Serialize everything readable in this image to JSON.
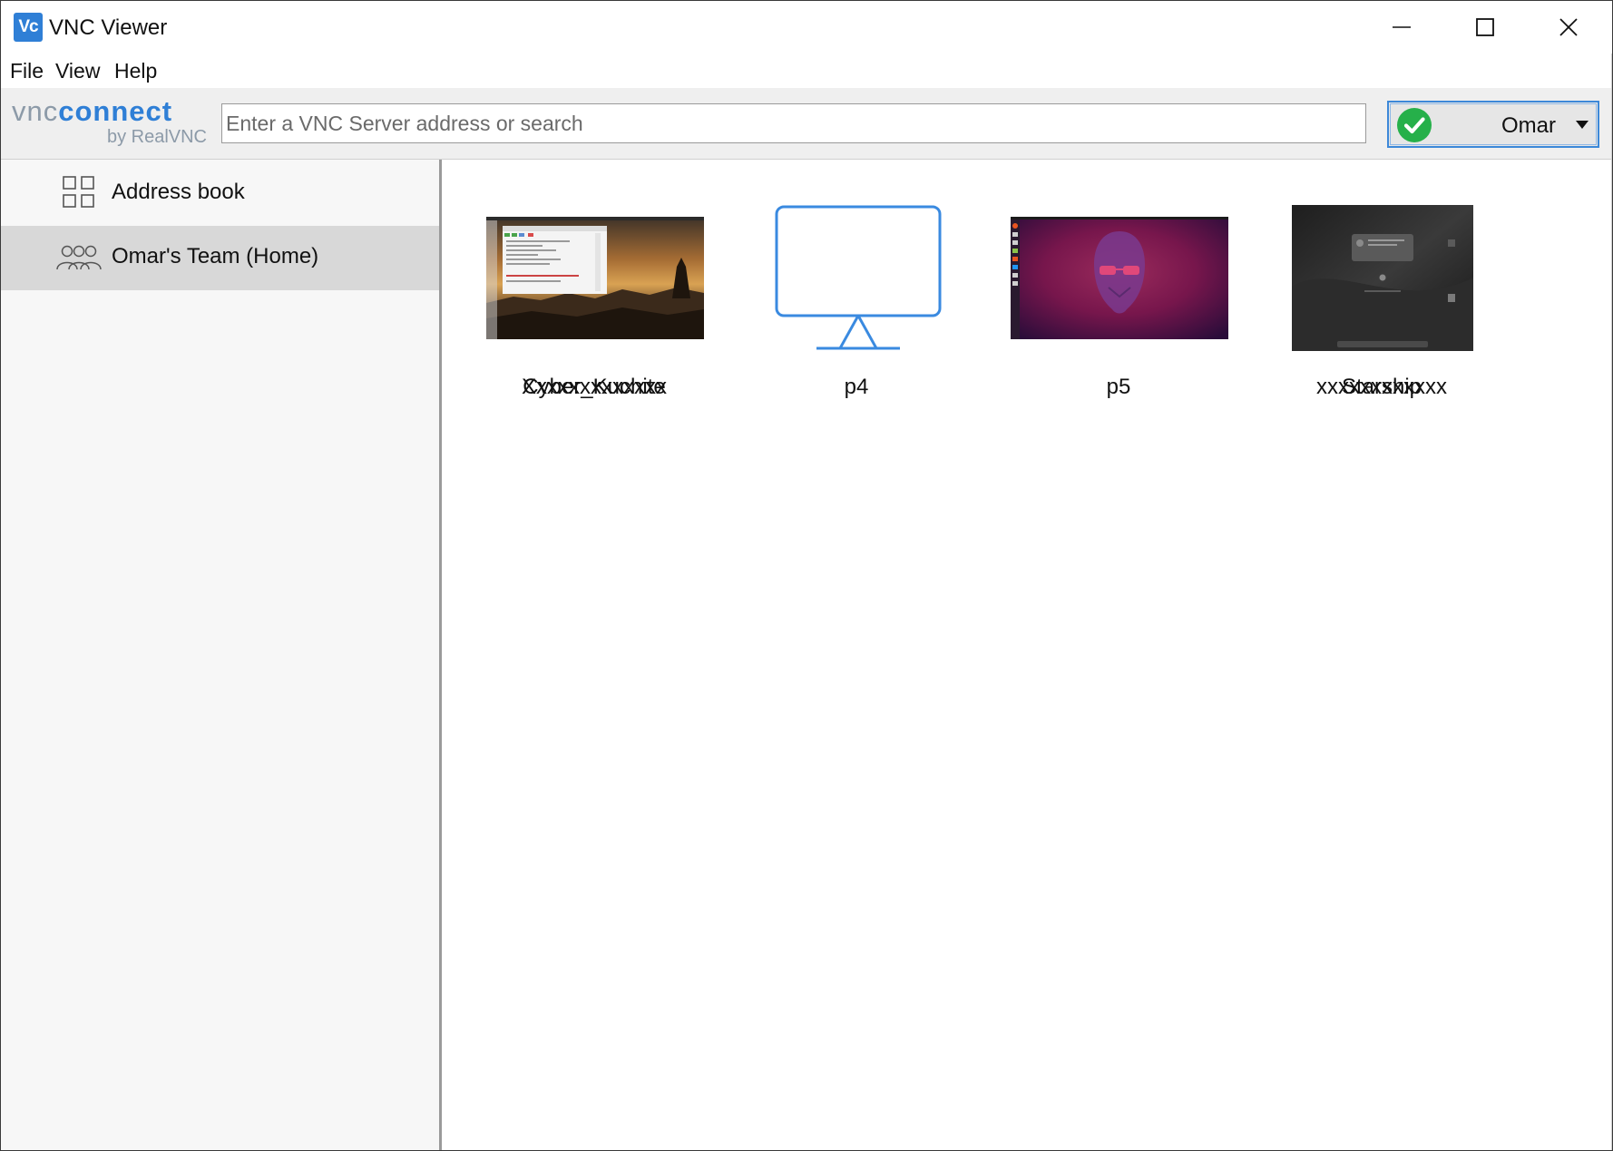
{
  "window": {
    "title": "VNC Viewer",
    "app_icon_text": "Vc",
    "controls": [
      "minimize-icon",
      "maximize-icon",
      "close-icon"
    ]
  },
  "menu": {
    "items": [
      "File",
      "View",
      "Help"
    ]
  },
  "toolbar": {
    "brand_vnc": "vnc",
    "brand_connect": "connect",
    "brand_sub": "by RealVNC",
    "search_placeholder": "Enter a VNC Server address or search",
    "account_name": "Omar",
    "account_status_color": "#26b04a"
  },
  "sidebar": {
    "items": [
      {
        "label": "Address book",
        "icon": "grid-icon",
        "selected": false
      },
      {
        "label": "Omar's Team (Home)",
        "icon": "team-icon",
        "selected": true
      }
    ]
  },
  "computers": [
    {
      "label_lines": [
        "Cyber_Kuchite",
        "Xxxxxxxxxxxxx"
      ],
      "thumbnail": "raspberry-pi-desktop-sunset"
    },
    {
      "label_lines": [
        "p4"
      ],
      "thumbnail": "monitor-icon"
    },
    {
      "label_lines": [
        "p5"
      ],
      "thumbnail": "ubuntu-gorilla-desktop"
    },
    {
      "label_lines": [
        "Starship",
        "xxxxxxxxxxxx"
      ],
      "thumbnail": "macos-dark-desktop"
    }
  ],
  "colors": {
    "accent": "#2f7fd6",
    "sidebar_bg": "#f7f7f7",
    "sidebar_selected": "#d8d8d8",
    "toolbar_bg": "#efefef"
  }
}
